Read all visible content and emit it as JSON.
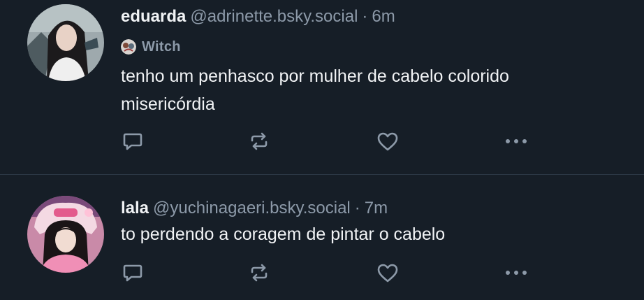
{
  "posts": [
    {
      "display_name": "eduarda",
      "handle": "@adrinette.bsky.social",
      "separator": "·",
      "time": "6m",
      "label": "Witch",
      "text": "tenho um penhasco por mulher de cabelo colorido\nmisericórdia",
      "avatar_icon": "profile-photo"
    },
    {
      "display_name": "lala",
      "handle": "@yuchinagaeri.bsky.social",
      "separator": "·",
      "time": "7m",
      "text": "to perdendo a coragem de pintar o cabelo",
      "avatar_icon": "profile-photo"
    }
  ],
  "actions": {
    "reply_icon": "reply-icon",
    "repost_icon": "repost-icon",
    "like_icon": "heart-icon",
    "more_icon": "more-options-icon"
  },
  "colors": {
    "background": "#161e27",
    "text_primary": "#f1f3f5",
    "text_secondary": "#8d9aa9",
    "icon": "#8d9aa9",
    "divider": "#2c3845"
  }
}
